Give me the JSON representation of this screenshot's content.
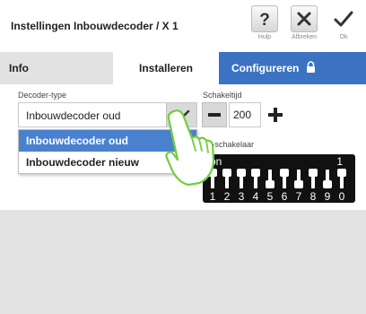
{
  "window": {
    "title": "Instellingen Inbouwdecoder / X 1"
  },
  "toolbar": {
    "help_label": "Hulp",
    "cancel_label": "Afbreken",
    "ok_label": "Ok"
  },
  "tabs": [
    {
      "label": "Info"
    },
    {
      "label": "Installeren"
    },
    {
      "label": "Configureren"
    }
  ],
  "decoder": {
    "label": "Decoder-type",
    "value": "Inbouwdecoder oud",
    "options": [
      "Inbouwdecoder oud",
      "Inbouwdecoder nieuw"
    ]
  },
  "switch_time": {
    "label": "Schakeltijd",
    "value": "200"
  },
  "dip": {
    "label": "Dil-schakelaar",
    "on_label": "on",
    "one_label": "1",
    "numbers": [
      "1",
      "2",
      "3",
      "4",
      "5",
      "6",
      "7",
      "8",
      "9",
      "0"
    ]
  },
  "colors": {
    "accent": "#3b73c2",
    "selected": "#4a81cf",
    "panel": "#e3e3e3",
    "dip_bg": "#111111"
  }
}
